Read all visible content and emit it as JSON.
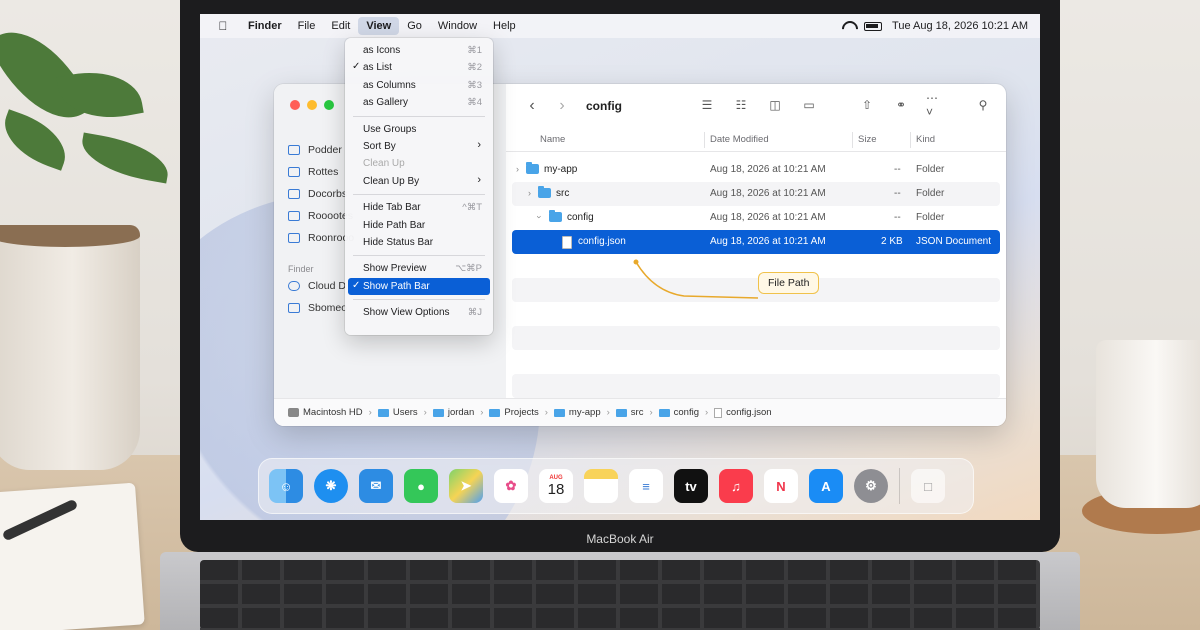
{
  "menubar": {
    "app_name": "Finder",
    "items": [
      "File",
      "Edit",
      "View",
      "Go",
      "Window",
      "Help"
    ],
    "datetime": "Tue Aug 18, 2026  10:21 AM"
  },
  "view_menu": {
    "items": [
      {
        "label": "as Icons",
        "shortcut": "⌘1",
        "checked": false
      },
      {
        "label": "as List",
        "shortcut": "⌘2",
        "checked": true
      },
      {
        "label": "as Columns",
        "shortcut": "⌘3",
        "checked": false
      },
      {
        "label": "as Gallery",
        "shortcut": "⌘4",
        "checked": false
      },
      {
        "label": "Use Groups",
        "shortcut": "",
        "checked": false
      },
      {
        "label": "Sort By",
        "shortcut": "",
        "submenu": true
      },
      {
        "label": "Clean Up",
        "shortcut": "",
        "disabled": true
      },
      {
        "label": "Clean Up By",
        "shortcut": "",
        "submenu": true
      },
      {
        "label": "Hide Tab Bar",
        "shortcut": "^⌘T"
      },
      {
        "label": "Hide Path Bar",
        "shortcut": ""
      },
      {
        "label": "Hide Status Bar",
        "shortcut": ""
      },
      {
        "label": "Show Preview",
        "shortcut": "⌥⌘P"
      },
      {
        "label": "Show Path Bar",
        "shortcut": "",
        "checked": true,
        "highlighted": true
      },
      {
        "label": "Show View Options",
        "shortcut": "⌘J"
      }
    ]
  },
  "sidebar": {
    "items": [
      "Podder",
      "Rottes",
      "Docorbs",
      "Rooootes",
      "Roonrooo"
    ],
    "section": "Finder",
    "cloud_items": [
      "Cloud D",
      "Sbomeo"
    ]
  },
  "toolbar": {
    "title": "config"
  },
  "columns": {
    "name": "Name",
    "date": "Date Modified",
    "size": "Size",
    "kind": "Kind"
  },
  "files": [
    {
      "name": "my-app",
      "date": "Aug 18, 2026 at 10:21 AM",
      "size": "--",
      "kind": "Folder"
    },
    {
      "name": "src",
      "date": "Aug 18, 2026 at 10:21 AM",
      "size": "--",
      "kind": "Folder"
    },
    {
      "name": "config",
      "date": "Aug 18, 2026 at 10:21 AM",
      "size": "--",
      "kind": "Folder"
    },
    {
      "name": "config.json",
      "date": "Aug 18, 2026 at 10:21 AM",
      "size": "2 KB",
      "kind": "JSON Document"
    }
  ],
  "callout": "File Path",
  "pathbar": [
    "Macintosh HD",
    "Users",
    "jordan",
    "Projects",
    "my-app",
    "src",
    "config",
    "config.json"
  ],
  "dock": {
    "calendar_month": "AUG",
    "calendar_day": "18",
    "tv_label": "tv"
  },
  "laptop_label": "MacBook Air"
}
